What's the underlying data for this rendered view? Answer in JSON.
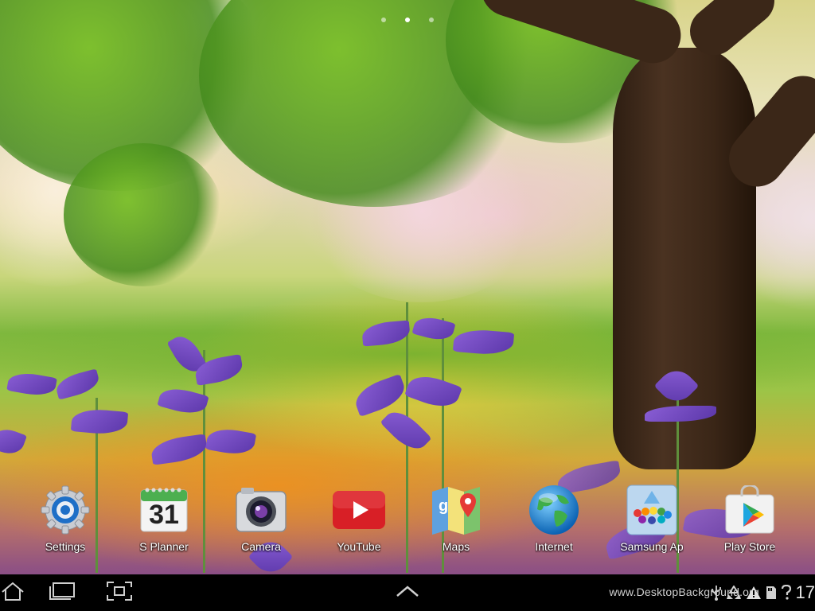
{
  "apps": [
    {
      "label": "Settings",
      "icon": "settings-gear-icon"
    },
    {
      "label": "S Planner",
      "icon": "calendar-icon",
      "day": "31"
    },
    {
      "label": "Camera",
      "icon": "camera-icon"
    },
    {
      "label": "YouTube",
      "icon": "youtube-play-icon"
    },
    {
      "label": "Maps",
      "icon": "maps-pin-icon"
    },
    {
      "label": "Internet",
      "icon": "globe-icon"
    },
    {
      "label": "Samsung Ap",
      "icon": "samsung-apps-icon"
    },
    {
      "label": "Play Store",
      "icon": "play-store-bag-icon"
    }
  ],
  "navbar": {
    "buttons": [
      "home-icon",
      "recent-apps-icon",
      "screenshot-capture-icon",
      "back-chevron-icon"
    ],
    "watermark": "www.DesktopBackground.org",
    "clock": "17",
    "status_icons": [
      "usb-icon",
      "recycle-icon",
      "warning-icon",
      "sd-card-icon",
      "question-icon"
    ]
  },
  "colors": {
    "navbar_bg": "#000000",
    "label_text": "#ffffff",
    "youtube_red": "#d81f26",
    "settings_blue": "#1e6fc7"
  }
}
